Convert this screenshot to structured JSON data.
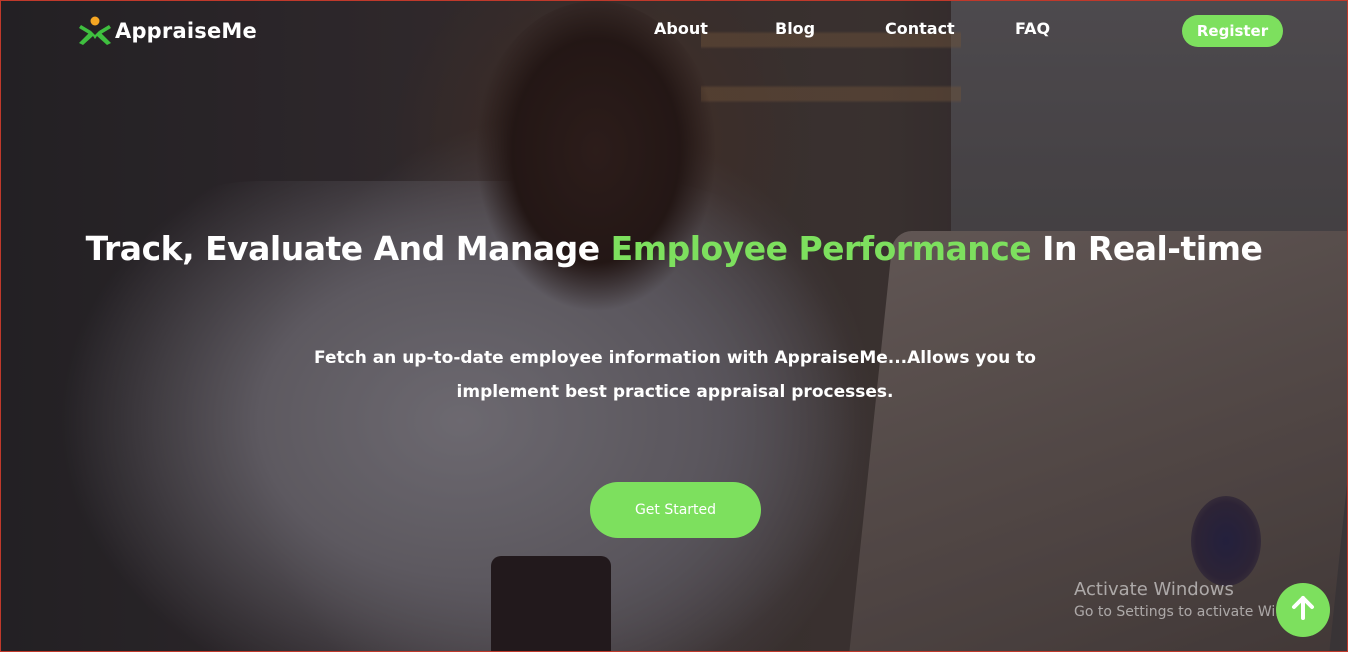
{
  "brand": {
    "name": "AppraiseMe",
    "accent_color": "#7de05e",
    "logo_icon": "person-raising-arms-icon"
  },
  "nav": {
    "links": [
      "About",
      "Blog",
      "Contact",
      "FAQ"
    ],
    "register_label": "Register"
  },
  "hero": {
    "headline_part1": "Track, Evaluate And Manage ",
    "headline_accent": "Employee Performance",
    "headline_part2": " In Real-time",
    "subtext": "Fetch an up-to-date employee information with AppraiseMe...Allows you to implement best practice appraisal processes.",
    "cta_label": "Get Started"
  },
  "os_watermark": {
    "title": "Activate Windows",
    "subtitle": "Go to Settings to activate Windows."
  },
  "scroll_top_icon": "arrow-up-icon"
}
